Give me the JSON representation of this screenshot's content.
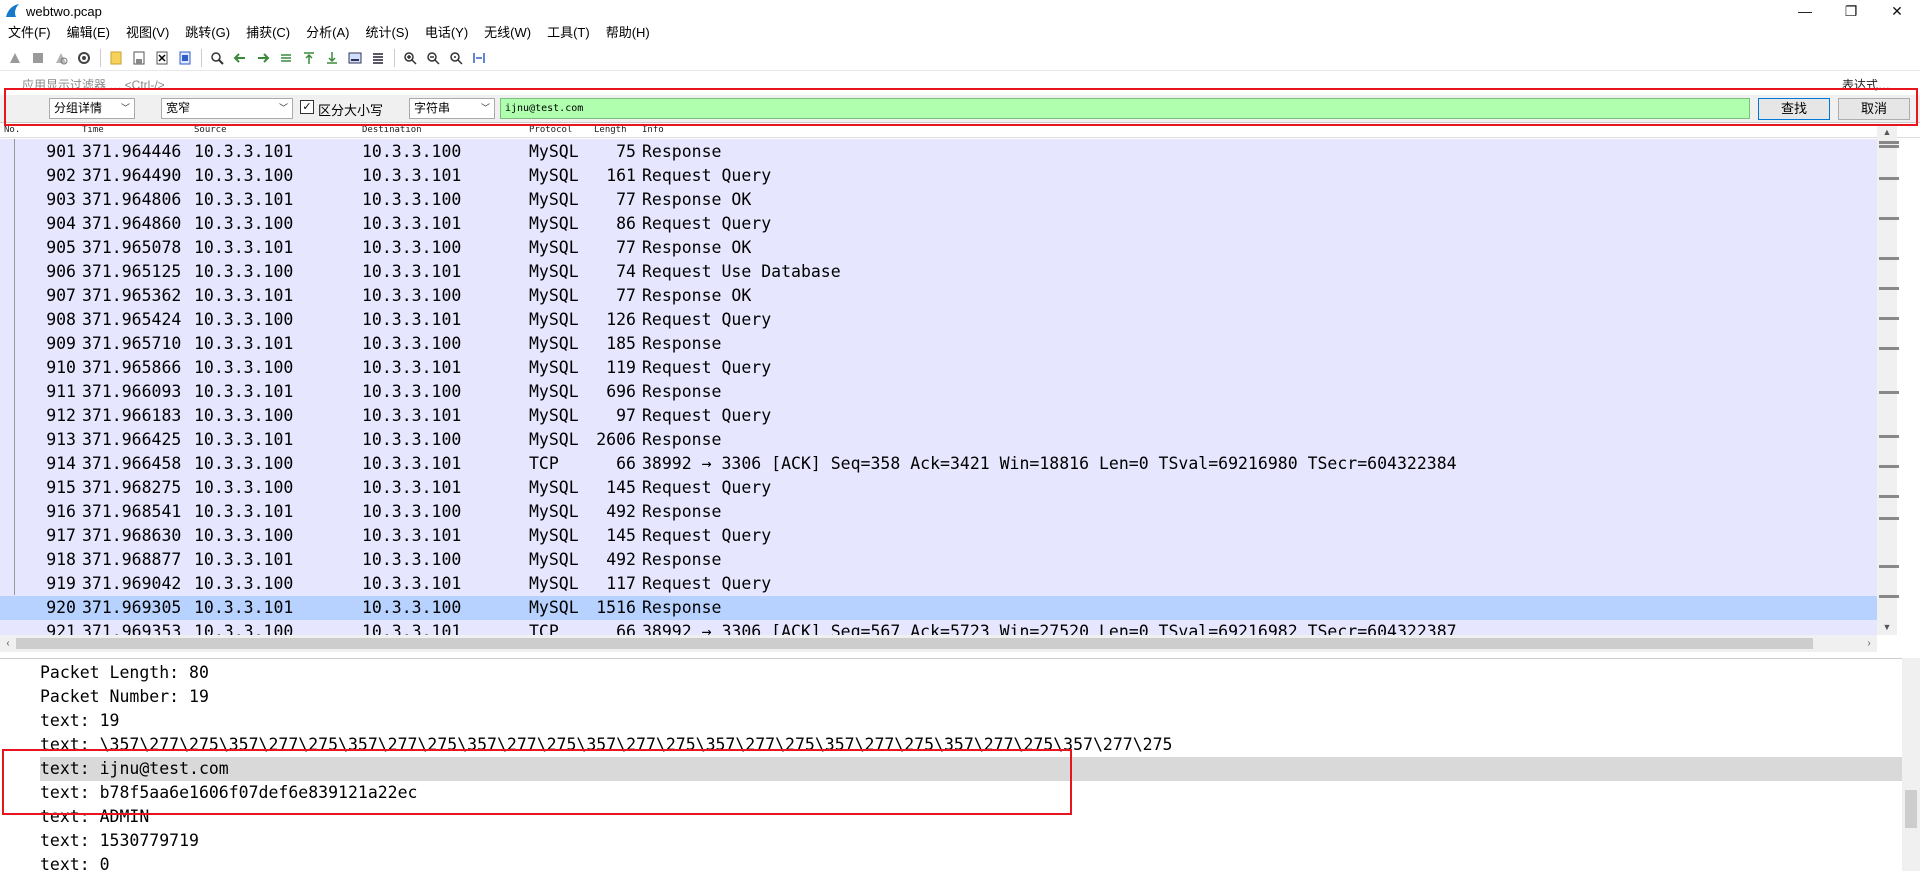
{
  "window": {
    "title": "webtwo.pcap"
  },
  "menu": [
    "文件(F)",
    "编辑(E)",
    "视图(V)",
    "跳转(G)",
    "捕获(C)",
    "分析(A)",
    "统计(S)",
    "电话(Y)",
    "无线(W)",
    "工具(T)",
    "帮助(H)"
  ],
  "filter": {
    "placeholder": "应用显示过滤器 … <Ctrl-/>",
    "expression_label": "表达式…"
  },
  "find": {
    "search_in": "分组详情",
    "char_width": "宽窄",
    "case_sensitive_label": "区分大小写",
    "case_sensitive_checked": "✓",
    "search_type": "字符串",
    "query": "ijnu@test.com",
    "find_label": "查找",
    "cancel_label": "取消"
  },
  "packet_list": {
    "columns": [
      "No.",
      "Time",
      "Source",
      "Destination",
      "Protocol",
      "Length",
      "Info"
    ],
    "rows": [
      {
        "no": "901",
        "time": "371.964446",
        "src": "10.3.3.101",
        "dst": "10.3.3.100",
        "proto": "MySQL",
        "len": "75",
        "info": "Response"
      },
      {
        "no": "902",
        "time": "371.964490",
        "src": "10.3.3.100",
        "dst": "10.3.3.101",
        "proto": "MySQL",
        "len": "161",
        "info": "Request Query"
      },
      {
        "no": "903",
        "time": "371.964806",
        "src": "10.3.3.101",
        "dst": "10.3.3.100",
        "proto": "MySQL",
        "len": "77",
        "info": "Response OK"
      },
      {
        "no": "904",
        "time": "371.964860",
        "src": "10.3.3.100",
        "dst": "10.3.3.101",
        "proto": "MySQL",
        "len": "86",
        "info": "Request Query"
      },
      {
        "no": "905",
        "time": "371.965078",
        "src": "10.3.3.101",
        "dst": "10.3.3.100",
        "proto": "MySQL",
        "len": "77",
        "info": "Response OK"
      },
      {
        "no": "906",
        "time": "371.965125",
        "src": "10.3.3.100",
        "dst": "10.3.3.101",
        "proto": "MySQL",
        "len": "74",
        "info": "Request Use Database"
      },
      {
        "no": "907",
        "time": "371.965362",
        "src": "10.3.3.101",
        "dst": "10.3.3.100",
        "proto": "MySQL",
        "len": "77",
        "info": "Response OK"
      },
      {
        "no": "908",
        "time": "371.965424",
        "src": "10.3.3.100",
        "dst": "10.3.3.101",
        "proto": "MySQL",
        "len": "126",
        "info": "Request Query"
      },
      {
        "no": "909",
        "time": "371.965710",
        "src": "10.3.3.101",
        "dst": "10.3.3.100",
        "proto": "MySQL",
        "len": "185",
        "info": "Response"
      },
      {
        "no": "910",
        "time": "371.965866",
        "src": "10.3.3.100",
        "dst": "10.3.3.101",
        "proto": "MySQL",
        "len": "119",
        "info": "Request Query"
      },
      {
        "no": "911",
        "time": "371.966093",
        "src": "10.3.3.101",
        "dst": "10.3.3.100",
        "proto": "MySQL",
        "len": "696",
        "info": "Response"
      },
      {
        "no": "912",
        "time": "371.966183",
        "src": "10.3.3.100",
        "dst": "10.3.3.101",
        "proto": "MySQL",
        "len": "97",
        "info": "Request Query"
      },
      {
        "no": "913",
        "time": "371.966425",
        "src": "10.3.3.101",
        "dst": "10.3.3.100",
        "proto": "MySQL",
        "len": "2606",
        "info": "Response"
      },
      {
        "no": "914",
        "time": "371.966458",
        "src": "10.3.3.100",
        "dst": "10.3.3.101",
        "proto": "TCP",
        "len": "66",
        "info": "38992 → 3306 [ACK] Seq=358 Ack=3421 Win=18816 Len=0 TSval=69216980 TSecr=604322384"
      },
      {
        "no": "915",
        "time": "371.968275",
        "src": "10.3.3.100",
        "dst": "10.3.3.101",
        "proto": "MySQL",
        "len": "145",
        "info": "Request Query"
      },
      {
        "no": "916",
        "time": "371.968541",
        "src": "10.3.3.101",
        "dst": "10.3.3.100",
        "proto": "MySQL",
        "len": "492",
        "info": "Response"
      },
      {
        "no": "917",
        "time": "371.968630",
        "src": "10.3.3.100",
        "dst": "10.3.3.101",
        "proto": "MySQL",
        "len": "145",
        "info": "Request Query"
      },
      {
        "no": "918",
        "time": "371.968877",
        "src": "10.3.3.101",
        "dst": "10.3.3.100",
        "proto": "MySQL",
        "len": "492",
        "info": "Response"
      },
      {
        "no": "919",
        "time": "371.969042",
        "src": "10.3.3.100",
        "dst": "10.3.3.101",
        "proto": "MySQL",
        "len": "117",
        "info": "Request Query"
      },
      {
        "no": "920",
        "time": "371.969305",
        "src": "10.3.3.101",
        "dst": "10.3.3.100",
        "proto": "MySQL",
        "len": "1516",
        "info": "Response",
        "selected": true
      },
      {
        "no": "921",
        "time": "371.969353",
        "src": "10.3.3.100",
        "dst": "10.3.3.101",
        "proto": "TCP",
        "len": "66",
        "info": "38992 → 3306 [ACK] Seq=567 Ack=5723 Win=27520 Len=0 TSval=69216982 TSecr=604322387"
      }
    ]
  },
  "detail": {
    "lines": [
      {
        "text": "Packet Length: 80"
      },
      {
        "text": "Packet Number: 19"
      },
      {
        "text": "text: 19"
      },
      {
        "text": "text: \\357\\277\\275\\357\\277\\275\\357\\277\\275\\357\\277\\275\\357\\277\\275\\357\\277\\275\\357\\277\\275\\357\\277\\275\\357\\277\\275"
      },
      {
        "text": "text: ijnu@test.com",
        "selected": true
      },
      {
        "text": "text: b78f5aa6e1606f07def6e839121a22ec"
      },
      {
        "text": "text: ADMIN"
      },
      {
        "text": "text: 1530779719"
      },
      {
        "text": "text: 0"
      }
    ]
  },
  "colors": {
    "row_bg": "#e7e6ff",
    "selected_row": "#b8d2ff",
    "find_input_bg": "#afffaf",
    "annotation": "#e8141e"
  }
}
